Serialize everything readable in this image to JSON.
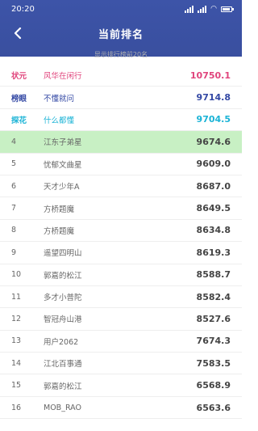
{
  "status_bar": {
    "time": "20:20"
  },
  "header": {
    "title": "当前排名"
  },
  "subtitle": "显示排行榜前20名",
  "colors": {
    "header_bg": "#3d54a8",
    "highlight_bg": "#c8f0c4",
    "gold": "#e0447c",
    "silver": "#3348a4",
    "bronze": "#1ab3d6"
  },
  "rows": [
    {
      "rank": "状元",
      "name": "风华在闲行",
      "score": "10750.1",
      "color": "#e0447c"
    },
    {
      "rank": "榜眼",
      "name": "不懂就问",
      "score": "9714.8",
      "color": "#3348a4"
    },
    {
      "rank": "探花",
      "name": "什么都懂",
      "score": "9704.5",
      "color": "#1ab3d6"
    },
    {
      "rank": "4",
      "name": "江东子弟星",
      "score": "9674.6",
      "highlight": true
    },
    {
      "rank": "5",
      "name": "忧郁文曲星",
      "score": "9609.0"
    },
    {
      "rank": "6",
      "name": "天才少年A",
      "score": "8687.0"
    },
    {
      "rank": "7",
      "name": "方桥题魔",
      "score": "8649.5"
    },
    {
      "rank": "8",
      "name": "方桥题魔",
      "score": "8634.8"
    },
    {
      "rank": "9",
      "name": "遥望四明山",
      "score": "8619.3"
    },
    {
      "rank": "10",
      "name": "郭嘉的松江",
      "score": "8588.7"
    },
    {
      "rank": "11",
      "name": "多才小普陀",
      "score": "8582.4"
    },
    {
      "rank": "12",
      "name": "智冠舟山港",
      "score": "8527.6"
    },
    {
      "rank": "13",
      "name": "用户2062",
      "score": "7674.3"
    },
    {
      "rank": "14",
      "name": "江北百事通",
      "score": "7583.5"
    },
    {
      "rank": "15",
      "name": "郭嘉的松江",
      "score": "6568.9"
    },
    {
      "rank": "16",
      "name": "MOB_RAO",
      "score": "6563.6"
    }
  ]
}
